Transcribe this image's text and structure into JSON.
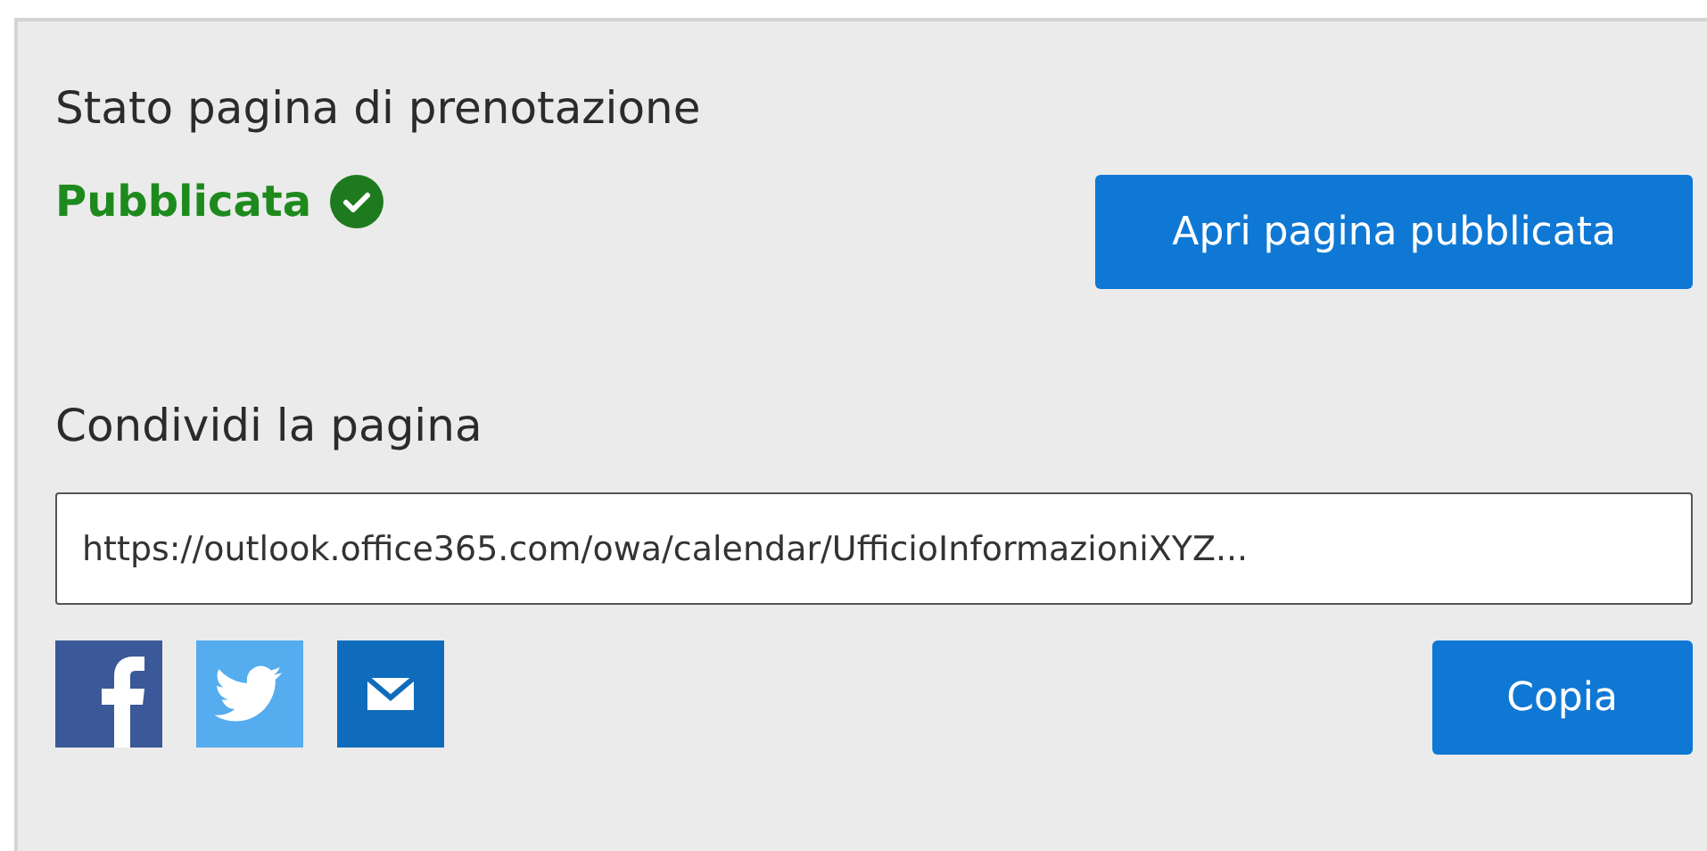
{
  "status_section": {
    "heading": "Stato pagina di prenotazione",
    "status": {
      "label": "Pubblicata",
      "published": true
    },
    "open_button": "Apri pagina pubblicata"
  },
  "share_section": {
    "heading": "Condividi la pagina",
    "link_field": {
      "value": "https://outlook.office365.com/owa/calendar/UfficioInformazioniXYZ..."
    },
    "copy_button": "Copia"
  }
}
